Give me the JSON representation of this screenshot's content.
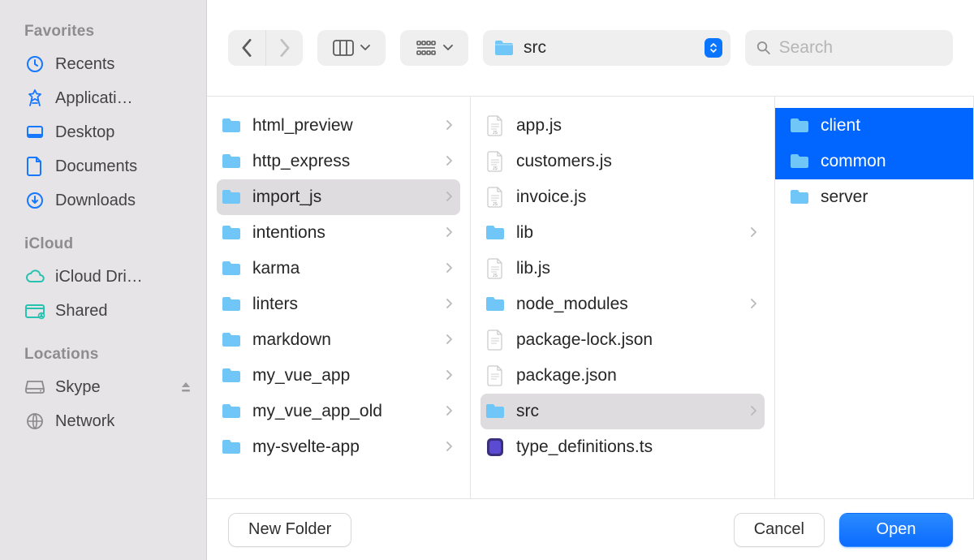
{
  "sidebar": {
    "sections": [
      {
        "header": "Favorites",
        "items": [
          {
            "icon": "clock",
            "label": "Recents"
          },
          {
            "icon": "apps",
            "label": "Applicati…"
          },
          {
            "icon": "desktop",
            "label": "Desktop"
          },
          {
            "icon": "doc",
            "label": "Documents"
          },
          {
            "icon": "download",
            "label": "Downloads"
          }
        ]
      },
      {
        "header": "iCloud",
        "items": [
          {
            "icon": "cloud",
            "label": "iCloud Dri…"
          },
          {
            "icon": "shared",
            "label": "Shared"
          }
        ]
      },
      {
        "header": "Locations",
        "items": [
          {
            "icon": "disk",
            "label": "Skype",
            "eject": true
          },
          {
            "icon": "network",
            "label": "Network"
          }
        ]
      }
    ]
  },
  "toolbar": {
    "folder_title": "src",
    "search_placeholder": "Search"
  },
  "columns": [
    [
      {
        "type": "folder",
        "name": "html_preview",
        "chev": true
      },
      {
        "type": "folder",
        "name": "http_express",
        "chev": true
      },
      {
        "type": "folder",
        "name": "import_js",
        "chev": true,
        "sel": "grey"
      },
      {
        "type": "folder",
        "name": "intentions",
        "chev": true
      },
      {
        "type": "folder",
        "name": "karma",
        "chev": true
      },
      {
        "type": "folder",
        "name": "linters",
        "chev": true
      },
      {
        "type": "folder",
        "name": "markdown",
        "chev": true
      },
      {
        "type": "folder",
        "name": "my_vue_app",
        "chev": true
      },
      {
        "type": "folder",
        "name": "my_vue_app_old",
        "chev": true
      },
      {
        "type": "folder",
        "name": "my-svelte-app",
        "chev": true
      }
    ],
    [
      {
        "type": "js",
        "name": "app.js"
      },
      {
        "type": "js",
        "name": "customers.js"
      },
      {
        "type": "js",
        "name": "invoice.js"
      },
      {
        "type": "folder",
        "name": "lib",
        "chev": true
      },
      {
        "type": "js",
        "name": "lib.js"
      },
      {
        "type": "folder",
        "name": "node_modules",
        "chev": true
      },
      {
        "type": "file",
        "name": "package-lock.json"
      },
      {
        "type": "file",
        "name": "package.json"
      },
      {
        "type": "folder",
        "name": "src",
        "chev": true,
        "sel": "grey"
      },
      {
        "type": "ts",
        "name": "type_definitions.ts"
      }
    ],
    [
      {
        "type": "folder",
        "name": "client",
        "sel": "blue"
      },
      {
        "type": "folder",
        "name": "common",
        "sel": "blue"
      },
      {
        "type": "folder",
        "name": "server"
      }
    ]
  ],
  "footer": {
    "new_folder": "New Folder",
    "cancel": "Cancel",
    "open": "Open"
  }
}
